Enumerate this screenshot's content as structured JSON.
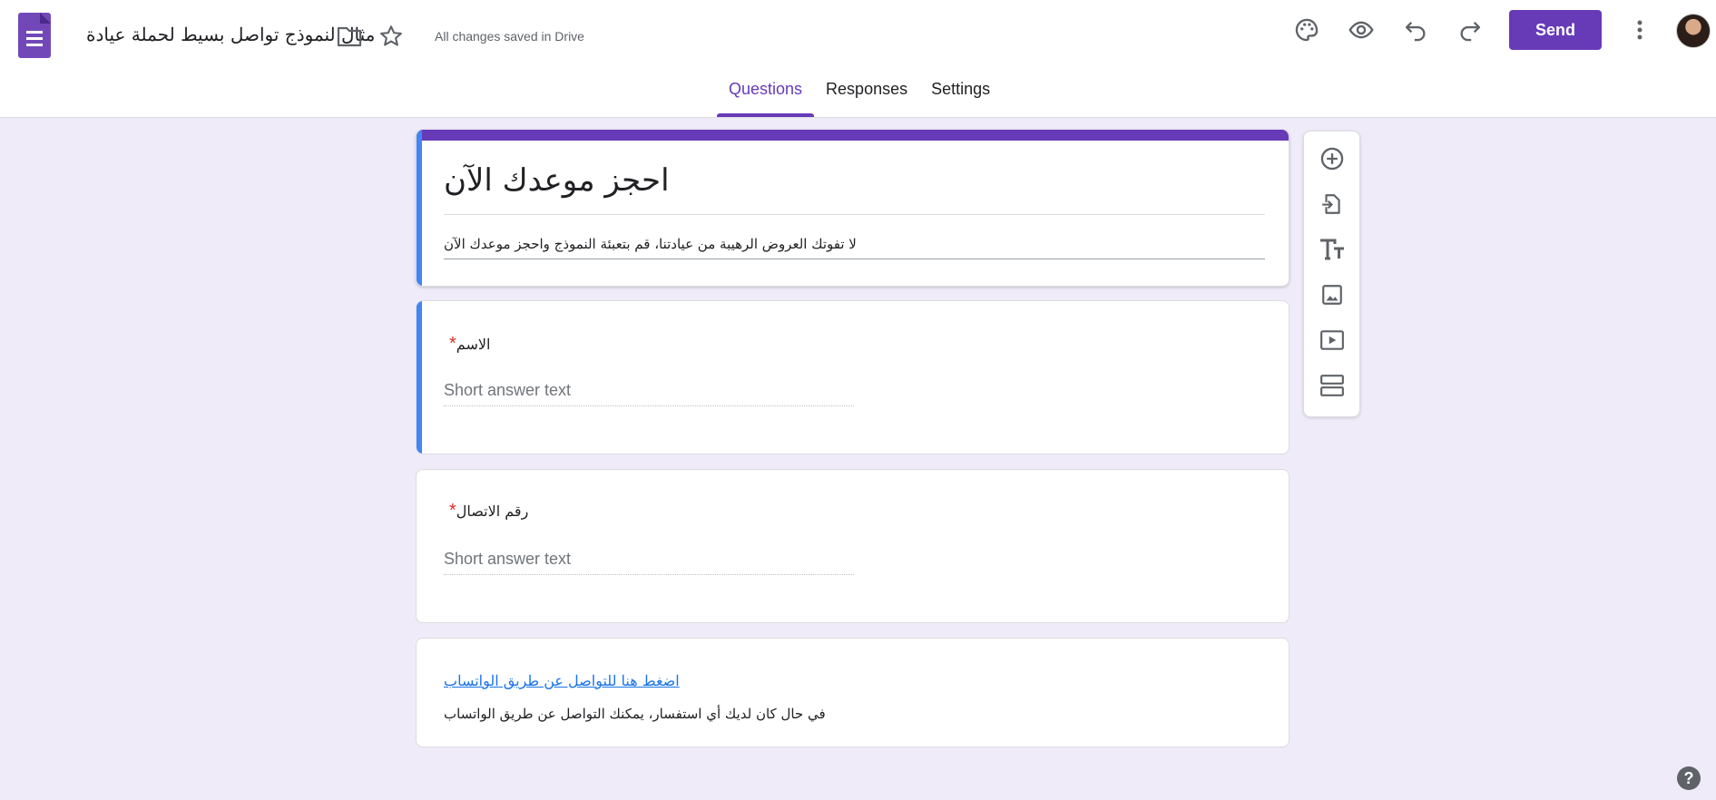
{
  "header": {
    "doc_title": "مثال لنموذج تواصل بسيط لحملة عيادة",
    "save_status": "All changes saved in Drive",
    "send_label": "Send",
    "icons": [
      "forms-logo-icon",
      "folder-icon",
      "star-icon",
      "palette-icon",
      "preview-eye-icon",
      "undo-icon",
      "redo-icon",
      "more-vert-icon"
    ]
  },
  "tabs": [
    {
      "label": "Questions",
      "active": true
    },
    {
      "label": "Responses",
      "active": false
    },
    {
      "label": "Settings",
      "active": false
    }
  ],
  "form": {
    "title": "احجز موعدك الآن",
    "description": "لا تفوتك العروض الرهيبة من عيادتنا، قم بتعبئة النموذج واحجز موعدك الآن",
    "accent_color": "#673ab7",
    "questions": [
      {
        "title": "الاسم",
        "required_mark": "*",
        "placeholder": "Short answer text"
      },
      {
        "title": "رقم الاتصال",
        "required_mark": "*",
        "placeholder": "Short answer text"
      }
    ],
    "contact": {
      "link_text": "اضغط هنا للتواصل عن طريق الواتساب",
      "note": "في حال كان لديك أي استفسار، يمكنك التواصل عن طريق الواتساب"
    }
  },
  "toolbar": [
    "add-question-icon",
    "import-questions-icon",
    "add-title-icon",
    "add-image-icon",
    "add-video-icon",
    "add-section-icon"
  ],
  "help_label": "?"
}
